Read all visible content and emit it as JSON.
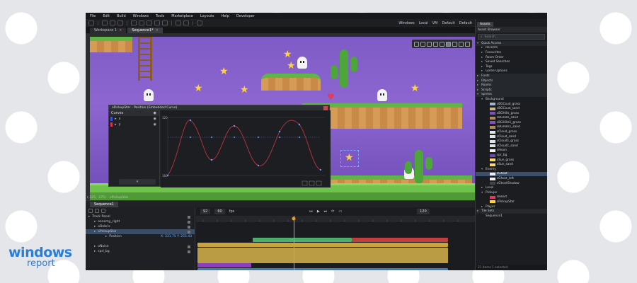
{
  "branding": {
    "line1": "windows",
    "line2": "report"
  },
  "menu": [
    "File",
    "Edit",
    "Build",
    "Windows",
    "Tools",
    "Marketplace",
    "Layouts",
    "Help",
    "Developer"
  ],
  "workspace_switch": [
    "Windows",
    "Local",
    "VM",
    "Default",
    "Default"
  ],
  "tabs": [
    {
      "label": "Workspace 1"
    },
    {
      "label": "Sequence1*"
    }
  ],
  "curve_window": {
    "title": "oPickupStar - Position (Embedded Curve)",
    "panel_header": "Curves",
    "channels": [
      {
        "label": "x",
        "color": "#3355dd"
      },
      {
        "label": "y",
        "color": "#dd3344"
      }
    ],
    "y_top": "320",
    "y_bottom": "160"
  },
  "status_coords": "(-325, -275)",
  "status_object": "oPickupStar",
  "timeline": {
    "sequence_tab": "Sequence1",
    "frame_current": "92",
    "frame_total": "60",
    "fps_label": "fps",
    "end_frame": "120",
    "tracks": [
      {
        "label": "Track Panel",
        "indent": 0
      },
      {
        "label": "oenemy_right",
        "indent": 1
      },
      {
        "label": "oDebris",
        "indent": 1
      },
      {
        "label": "oPickupStar",
        "indent": 1,
        "selected": true
      },
      {
        "label": "Position",
        "indent": 3
      },
      {
        "label": "",
        "indent": 0
      },
      {
        "label": "oNoise",
        "indent": 1
      },
      {
        "label": "sprI_bg",
        "indent": 1
      }
    ],
    "position_value": "X: 331.75  Y: 255.43"
  },
  "assets": {
    "tabs": [
      "Assets"
    ],
    "title": "Asset Browser",
    "search_placeholder": "Search...",
    "items": [
      {
        "label": "Quick Access",
        "type": "sec",
        "tri": "▾"
      },
      {
        "label": "Recents",
        "level": 1,
        "tri": "▸"
      },
      {
        "label": "Favourites",
        "level": 1,
        "tri": "▸"
      },
      {
        "label": "Room Order",
        "level": 1,
        "tri": "▸"
      },
      {
        "label": "Saved Searches",
        "level": 1,
        "tri": "▸"
      },
      {
        "label": "Tags",
        "level": 1,
        "tri": "▸"
      },
      {
        "label": "Game Options",
        "level": 1,
        "tri": "▸"
      },
      {
        "label": "Fonts",
        "type": "sec",
        "tri": "▸"
      },
      {
        "label": "Objects",
        "type": "sec",
        "tri": "▸"
      },
      {
        "label": "Rooms",
        "type": "sec",
        "tri": "▸"
      },
      {
        "label": "Scripts",
        "type": "sec",
        "tri": "▸"
      },
      {
        "label": "Sprites",
        "type": "sec",
        "tri": "▾"
      },
      {
        "label": "Background",
        "level": 1,
        "tri": "▾"
      },
      {
        "label": "sBGCoud_grass",
        "level": 2,
        "sw": "#9fb4d0"
      },
      {
        "label": "sBGCoud_sand",
        "level": 2,
        "sw": "#cfb690"
      },
      {
        "label": "sBGHills_grass",
        "level": 2,
        "sw": "#7a55c0"
      },
      {
        "label": "sBGHills_sand",
        "level": 2,
        "sw": "#b48a5a"
      },
      {
        "label": "sBGHills1_grass",
        "level": 2,
        "sw": "#7a55c0"
      },
      {
        "label": "sBGHills1_sand",
        "level": 2,
        "sw": "#b48a5a"
      },
      {
        "label": "sCloud_grass",
        "level": 2,
        "sw": "#e0e4ea"
      },
      {
        "label": "sCloud_sand",
        "level": 2,
        "sw": "#e0e4ea"
      },
      {
        "label": "sCloud1_grass",
        "level": 2,
        "sw": "#e0e4ea"
      },
      {
        "label": "sCloud1_sand",
        "level": 2,
        "sw": "#e0e4ea"
      },
      {
        "label": "sMoon",
        "level": 2,
        "sw": "#f3f3f3"
      },
      {
        "label": "spr_bg",
        "level": 2,
        "sw": "#6a4aa8"
      },
      {
        "label": "sSun_grass",
        "level": 2,
        "sw": "#ffd86a"
      },
      {
        "label": "sSun_sand",
        "level": 2,
        "sw": "#ffd86a"
      },
      {
        "label": "Enemy",
        "level": 1,
        "tri": "▾"
      },
      {
        "label": "sGhost",
        "level": 2,
        "sw": "#eeeeee",
        "selected": true
      },
      {
        "label": "sGhost_left",
        "level": 2,
        "sw": "#eeeeee"
      },
      {
        "label": "sGhostShadow",
        "level": 2,
        "sw": "#444444"
      },
      {
        "label": "Level",
        "level": 1,
        "tri": "▸"
      },
      {
        "label": "Pickups",
        "level": 1,
        "tri": "▾"
      },
      {
        "label": "sHeart",
        "level": 2,
        "sw": "#e53b5a"
      },
      {
        "label": "sPickupStar",
        "level": 2,
        "sw": "#ffd43b"
      },
      {
        "label": "Player",
        "level": 1,
        "tri": "▸"
      },
      {
        "label": "Tile Sets",
        "type": "sec",
        "tri": "▸"
      },
      {
        "label": "Sequence1",
        "level": 1,
        "tri": ""
      }
    ],
    "status": "21 items   1 selected"
  }
}
